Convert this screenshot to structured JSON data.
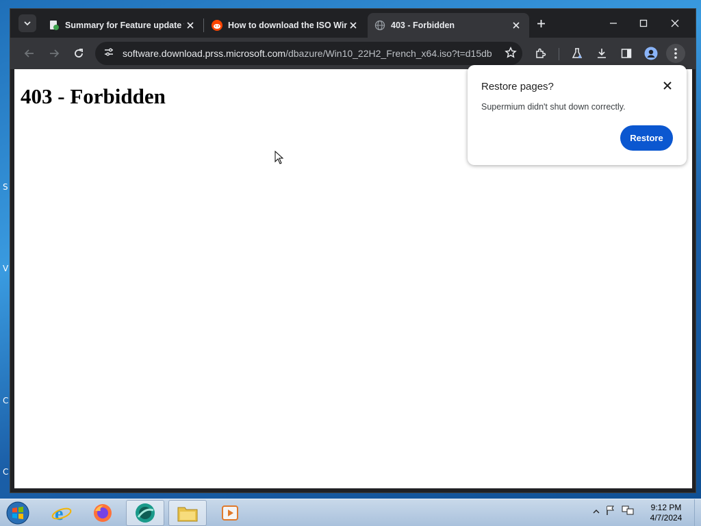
{
  "tabs": [
    {
      "title": "Summary for Feature update t",
      "favicon": "windows-update-icon"
    },
    {
      "title": "How to download the ISO Win",
      "favicon": "reddit-icon"
    },
    {
      "title": "403 - Forbidden",
      "favicon": "globe-icon"
    }
  ],
  "omnibox": {
    "host": "software.download.prss.microsoft.com",
    "path": "/dbazure/Win10_22H2_French_x64.iso?t=d15db..."
  },
  "page": {
    "heading": "403 - Forbidden"
  },
  "popup": {
    "title": "Restore pages?",
    "message": "Supermium didn't shut down correctly.",
    "button": "Restore"
  },
  "taskbar": {
    "time": "9:12 PM",
    "date": "4/7/2024"
  },
  "desktop_fragments": [
    "S",
    "V",
    "C",
    "C"
  ],
  "colors": {
    "accent": "#0b57d0",
    "chrome_dark": "#202124",
    "toolbar": "#35363a"
  }
}
